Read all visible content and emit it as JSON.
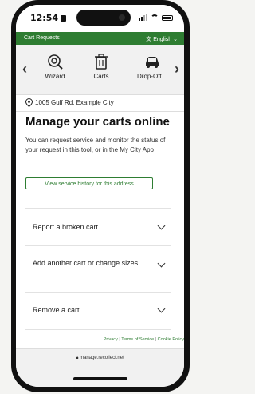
{
  "status": {
    "time": "12:54"
  },
  "topbar": {
    "title": "Cart Requests",
    "language": "English"
  },
  "nav": {
    "items": [
      {
        "label": "Wizard",
        "icon": "wizard-icon"
      },
      {
        "label": "Carts",
        "icon": "trash-cart-icon"
      },
      {
        "label": "Drop-Off",
        "icon": "car-icon"
      }
    ]
  },
  "address": {
    "text": "1005 Gulf Rd, Example City"
  },
  "page": {
    "title": "Manage your carts online",
    "intro": "You can request service and monitor the status of your request in this tool, or in the My City App",
    "history_button": "View service history for this address"
  },
  "accordion": [
    {
      "label": "Report a broken cart"
    },
    {
      "label": "Add another cart or change sizes"
    },
    {
      "label": "Remove a cart"
    }
  ],
  "footer": {
    "privacy": "Privacy",
    "terms": "Terms of Service",
    "cookie": "Cookie Policy",
    "sep": "|"
  },
  "browser": {
    "url": "manage.recollect.net"
  },
  "colors": {
    "brand": "#2e7d32"
  }
}
